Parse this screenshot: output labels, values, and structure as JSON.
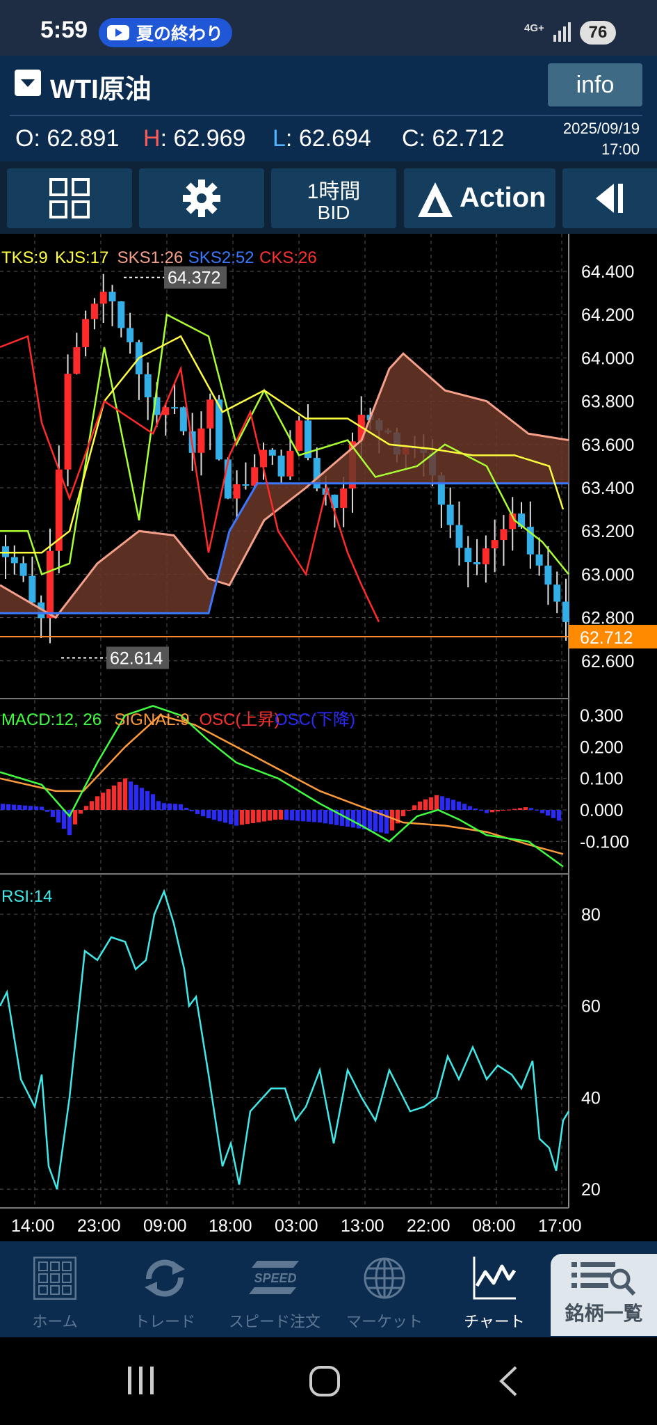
{
  "status_bar": {
    "time": "5:59",
    "notification": "夏の終わり",
    "network": "4G+",
    "battery": "76"
  },
  "header": {
    "symbol": "WTI原油",
    "info_label": "info",
    "ohlc": [
      {
        "key": "O",
        "value": "62.891",
        "key_color": "#ffffff"
      },
      {
        "key": "H",
        "value": "62.969",
        "key_color": "#ff5a5a"
      },
      {
        "key": "L",
        "value": "62.694",
        "key_color": "#4fb3ff"
      },
      {
        "key": "C",
        "value": "62.712",
        "key_color": "#ffffff"
      }
    ],
    "date": "2025/09/19",
    "time": "17:00"
  },
  "toolbar": {
    "timeframe": "1時間",
    "price_type": "BID",
    "action_label": "Action"
  },
  "indicators": {
    "ichimoku": [
      {
        "label": "TKS:9",
        "color": "#ffff40"
      },
      {
        "label": "KJS:17",
        "color": "#ffff40"
      },
      {
        "label": "SKS1:26",
        "color": "#f5a08a"
      },
      {
        "label": "SKS2:52",
        "color": "#3a78ff"
      },
      {
        "label": "CKS:26",
        "color": "#ff3030"
      }
    ],
    "macd": [
      {
        "label": "MACD:12, 26",
        "color": "#40ff40"
      },
      {
        "label": "SIGNAL:9",
        "color": "#ff9a3a"
      },
      {
        "label": "OSC(上昇)",
        "color": "#ff3030"
      },
      {
        "label": "OSC(下降)",
        "color": "#2a2aff"
      }
    ],
    "rsi": {
      "label": "RSI:14",
      "color": "#40e8e8"
    }
  },
  "price_axis": [
    "64.400",
    "64.200",
    "64.000",
    "63.800",
    "63.600",
    "63.400",
    "63.200",
    "63.000",
    "62.800",
    "62.600"
  ],
  "current_price": "62.712",
  "high_marker": "64.372",
  "low_marker": "62.614",
  "macd_axis": [
    "0.300",
    "0.200",
    "0.100",
    "0.000",
    "-0.100"
  ],
  "rsi_axis": [
    "80",
    "60",
    "40",
    "20"
  ],
  "time_axis": [
    "14:00",
    "23:00",
    "09:00",
    "18:00",
    "03:00",
    "13:00",
    "22:00",
    "08:00",
    "17:00"
  ],
  "bottom_nav": [
    {
      "label": "ホーム",
      "icon": "home-grid-icon"
    },
    {
      "label": "トレード",
      "icon": "trade-cycle-icon"
    },
    {
      "label": "スピード注文",
      "icon": "speed-order-icon"
    },
    {
      "label": "マーケット",
      "icon": "globe-icon"
    },
    {
      "label": "チャート",
      "icon": "chart-icon"
    },
    {
      "label": "銘柄一覧",
      "icon": "list-search-icon"
    }
  ]
}
